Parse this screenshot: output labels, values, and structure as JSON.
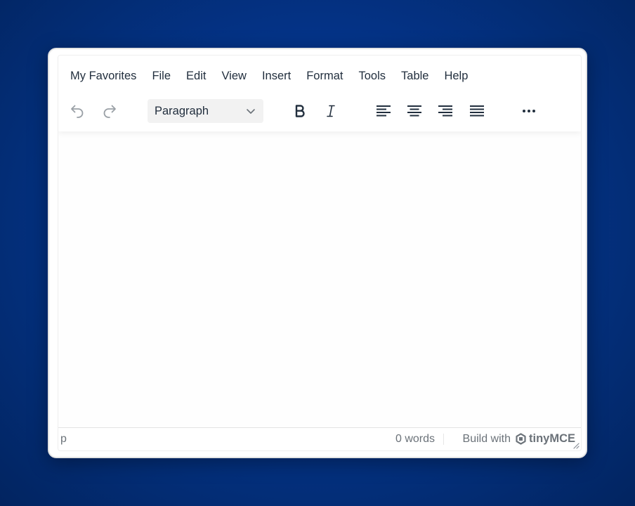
{
  "menubar": {
    "items": [
      "My Favorites",
      "File",
      "Edit",
      "View",
      "Insert",
      "Format",
      "Tools",
      "Table",
      "Help"
    ]
  },
  "toolbar": {
    "undo_icon": "undo-icon",
    "redo_icon": "redo-icon",
    "block_format": "Paragraph",
    "bold_icon": "bold-icon",
    "italic_icon": "italic-icon",
    "align_left_icon": "align-left-icon",
    "align_center_icon": "align-center-icon",
    "align_right_icon": "align-right-icon",
    "align_justify_icon": "align-justify-icon",
    "more_icon": "more-icon"
  },
  "content": {
    "text": ""
  },
  "statusbar": {
    "path": "p",
    "word_count": "0 words",
    "branding_prefix": "Build with",
    "branding_name": "tinyMCE"
  },
  "colors": {
    "background": "#04348a",
    "text": "#222f3e",
    "status_text": "#6b7279",
    "disabled_icon": "#9aa0a6"
  }
}
